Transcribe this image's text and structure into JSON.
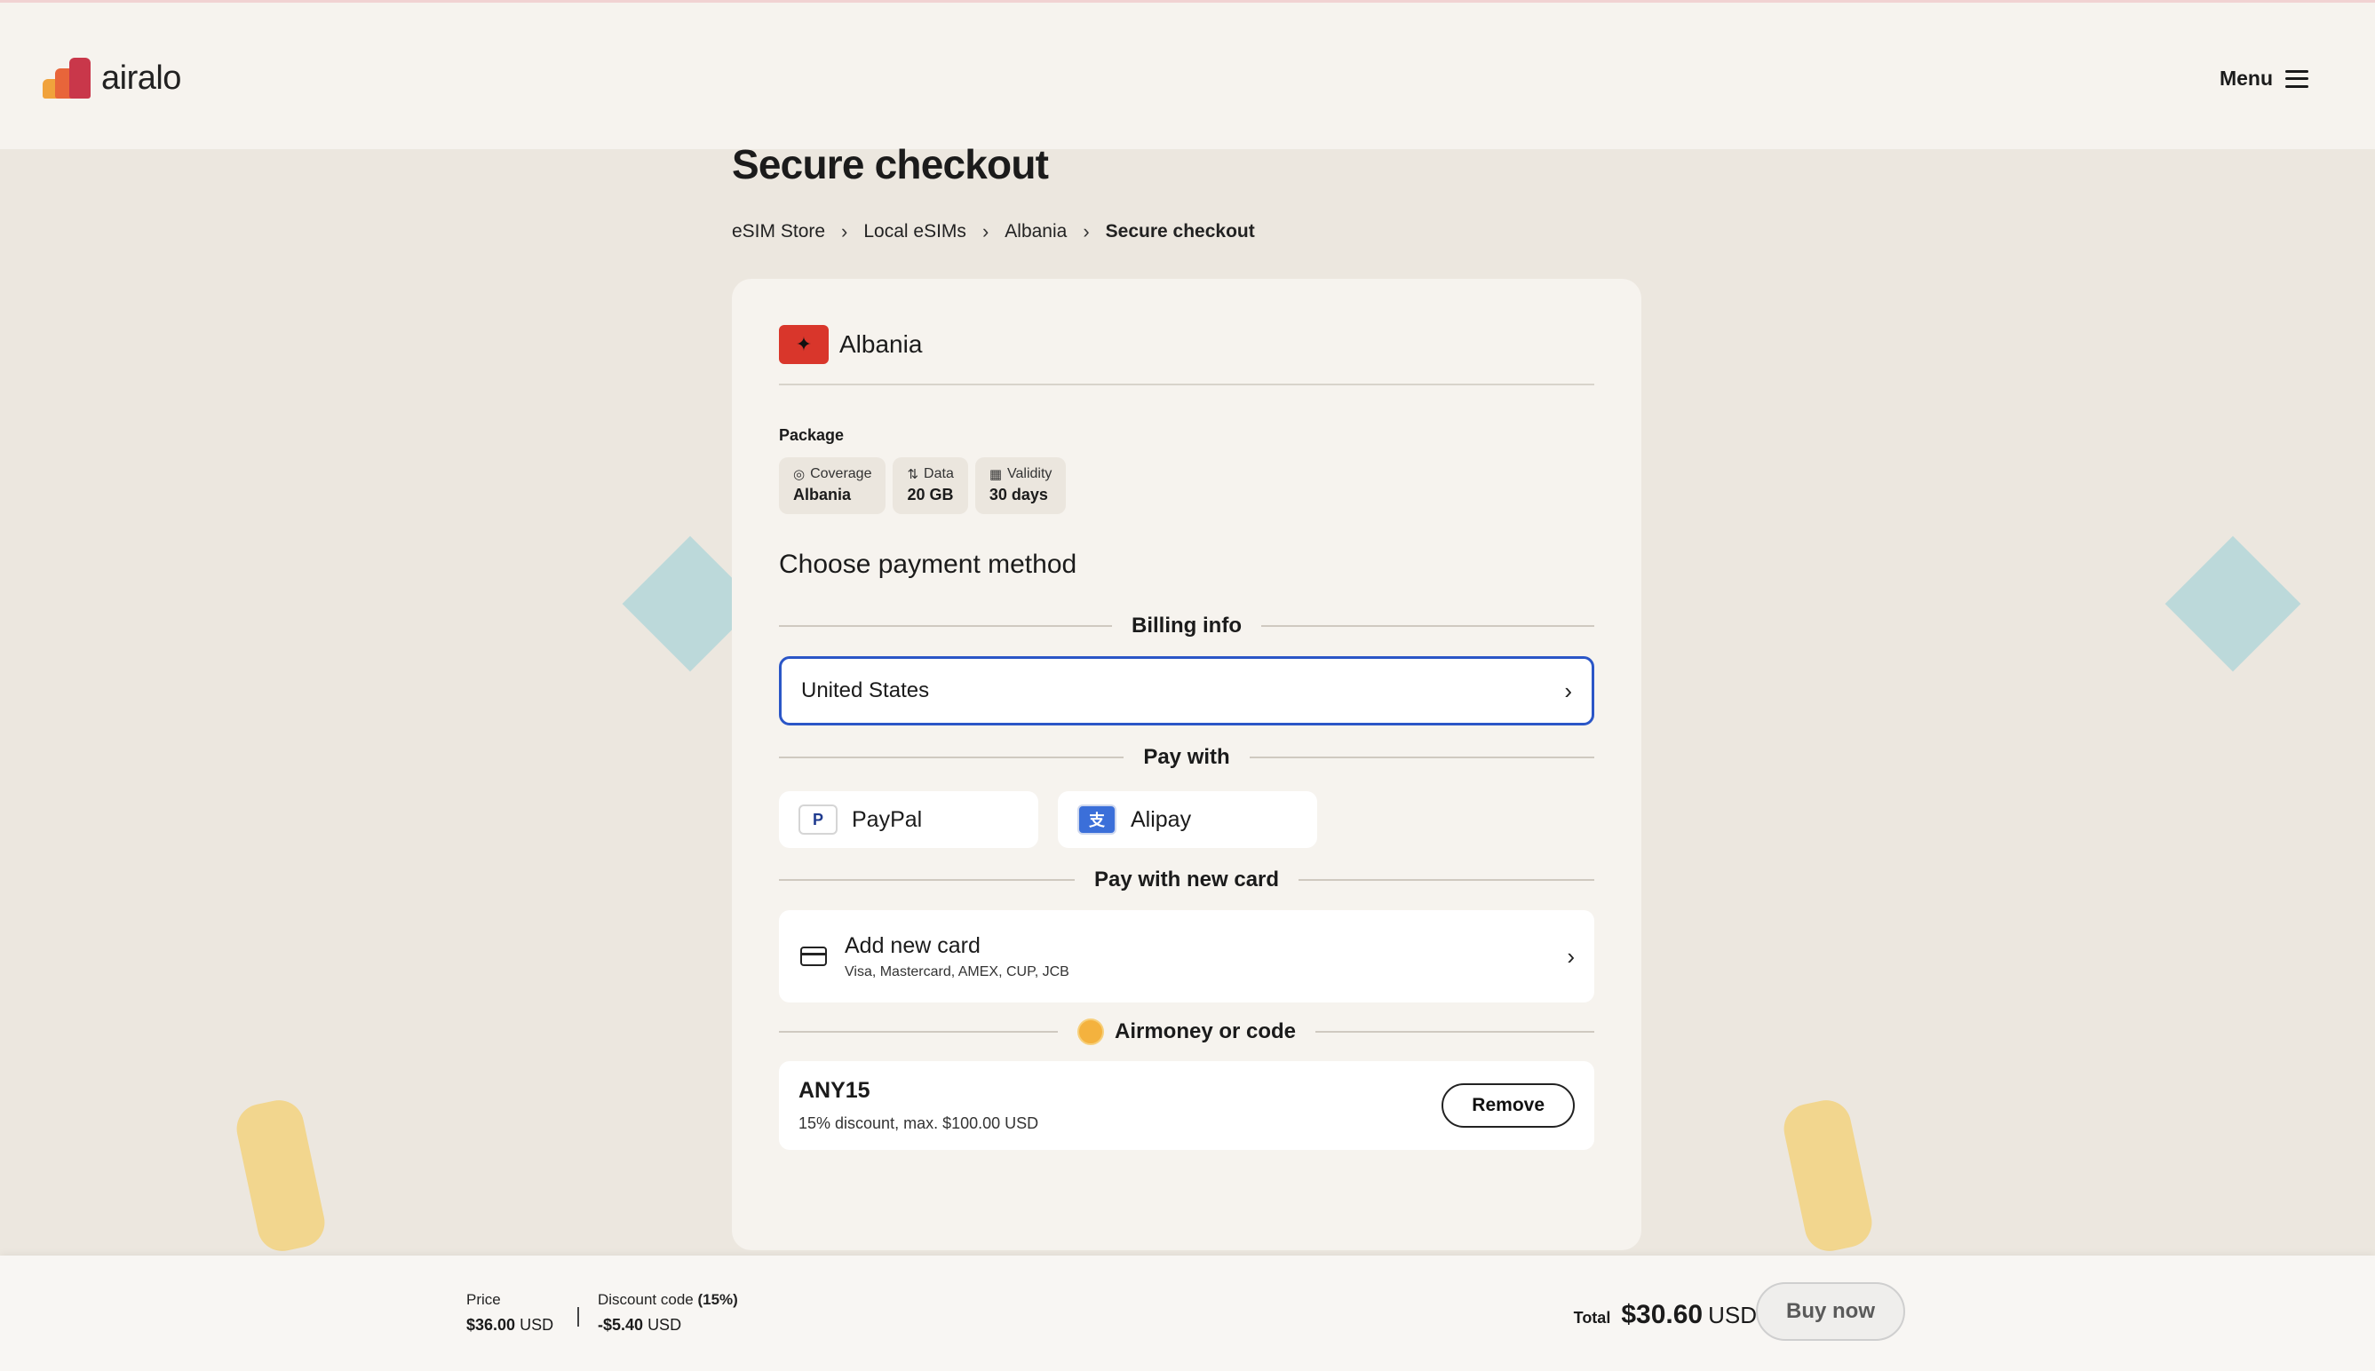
{
  "header": {
    "logo_text": "airalo",
    "menu_label": "Menu"
  },
  "page": {
    "title": "Secure checkout",
    "breadcrumbs": [
      "eSIM Store",
      "Local eSIMs",
      "Albania",
      "Secure checkout"
    ]
  },
  "card": {
    "country": "Albania",
    "package_label": "Package",
    "package": [
      {
        "label": "Coverage",
        "value": "Albania",
        "icon": "location-pin-icon"
      },
      {
        "label": "Data",
        "value": "20 GB",
        "icon": "data-arrows-icon"
      },
      {
        "label": "Validity",
        "value": "30 days",
        "icon": "calendar-icon"
      }
    ],
    "payment_title": "Choose payment method",
    "billing_label": "Billing info",
    "billing_country": "United States",
    "pay_with_label": "Pay with",
    "pay_options": [
      {
        "name": "PayPal",
        "icon_glyph": "P"
      },
      {
        "name": "Alipay",
        "icon_glyph": "支"
      }
    ],
    "new_card_label": "Pay with new card",
    "add_card_title": "Add new card",
    "add_card_sub": "Visa, Mastercard, AMEX, CUP, JCB",
    "airmoney_label": "Airmoney or code",
    "code": {
      "name": "ANY15",
      "desc": "15% discount, max. $100.00 USD",
      "remove_label": "Remove"
    }
  },
  "bottom": {
    "price_label": "Price",
    "price_value": "$36.00",
    "price_unit": "USD",
    "discount_label": "Discount code",
    "discount_pct": "(15%)",
    "discount_value": "-$5.40",
    "discount_unit": "USD",
    "total_label": "Total",
    "total_value": "$30.60",
    "total_unit": "USD",
    "buy_label": "Buy now"
  },
  "colors": {
    "background": "#ece7df",
    "card": "#f6f3ee",
    "accent_border": "#2b56c7",
    "brand_red": "#c9374a",
    "brand_orange": "#e8653a"
  }
}
